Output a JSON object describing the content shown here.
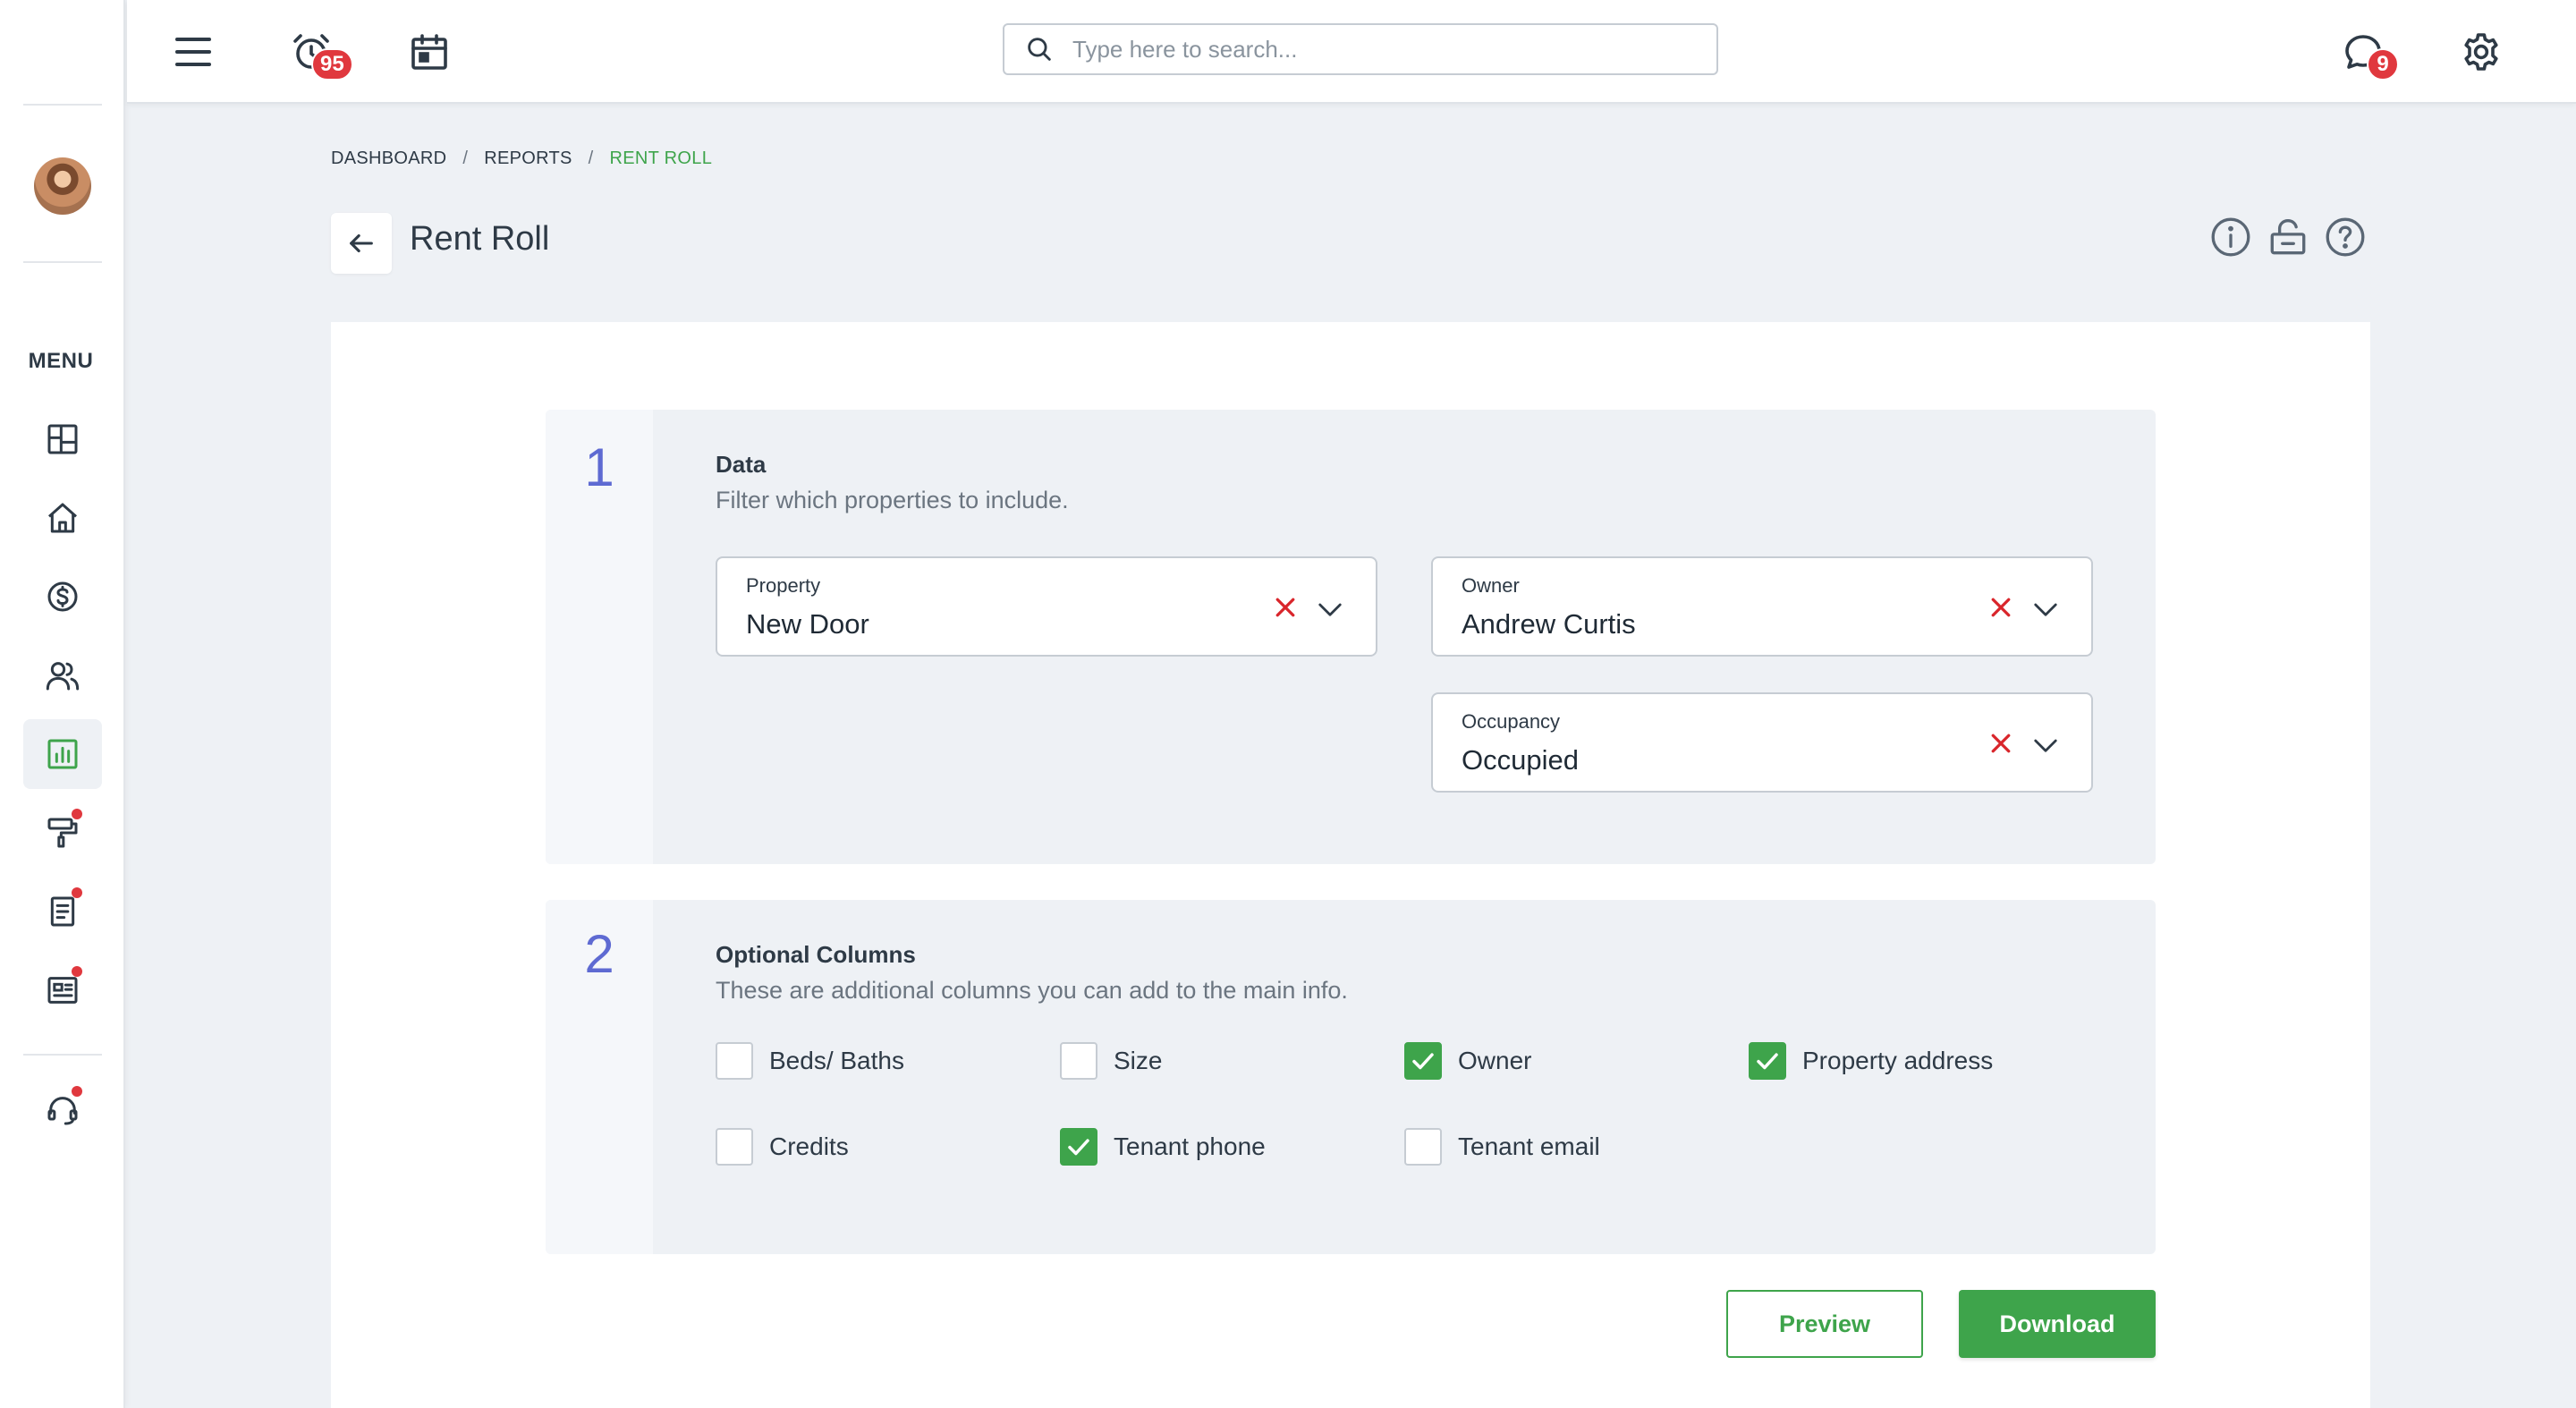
{
  "header": {
    "alarm_badge": "95",
    "messages_badge": "9",
    "search_placeholder": "Type here to search..."
  },
  "sidebar": {
    "menu_label": "MENU",
    "items": [
      {
        "icon": "dashboard-icon",
        "active": false,
        "dot": false
      },
      {
        "icon": "home-icon",
        "active": false,
        "dot": false
      },
      {
        "icon": "dollar-icon",
        "active": false,
        "dot": false
      },
      {
        "icon": "people-icon",
        "active": false,
        "dot": false
      },
      {
        "icon": "reports-chart-icon",
        "active": true,
        "dot": false
      },
      {
        "icon": "maintenance-roller-icon",
        "active": false,
        "dot": true
      },
      {
        "icon": "document-icon",
        "active": false,
        "dot": true
      },
      {
        "icon": "listing-icon",
        "active": false,
        "dot": true
      },
      {
        "icon": "support-headset-icon",
        "active": false,
        "dot": true
      }
    ]
  },
  "breadcrumb": [
    "DASHBOARD",
    "REPORTS",
    "RENT ROLL"
  ],
  "page_title": "Rent Roll",
  "section1": {
    "number": "1",
    "title": "Data",
    "subtitle": "Filter which properties to include.",
    "fields": {
      "property": {
        "label": "Property",
        "value": "New Door"
      },
      "owner": {
        "label": "Owner",
        "value": "Andrew Curtis"
      },
      "occupancy": {
        "label": "Occupancy",
        "value": "Occupied"
      }
    }
  },
  "section2": {
    "number": "2",
    "title": "Optional Columns",
    "subtitle": "These are additional columns you can add to the main info.",
    "options": [
      {
        "label": "Beds/ Baths",
        "checked": false
      },
      {
        "label": "Size",
        "checked": false
      },
      {
        "label": "Owner",
        "checked": true
      },
      {
        "label": "Property address",
        "checked": true
      },
      {
        "label": "Credits",
        "checked": false
      },
      {
        "label": "Tenant phone",
        "checked": true
      },
      {
        "label": "Tenant email",
        "checked": false
      }
    ]
  },
  "actions": {
    "preview_label": "Preview",
    "download_label": "Download"
  },
  "colors": {
    "accent_green": "#3ea44b",
    "section_number": "#5e6ad2",
    "badge_red": "#e0383e",
    "clear_red": "#d9252b"
  }
}
